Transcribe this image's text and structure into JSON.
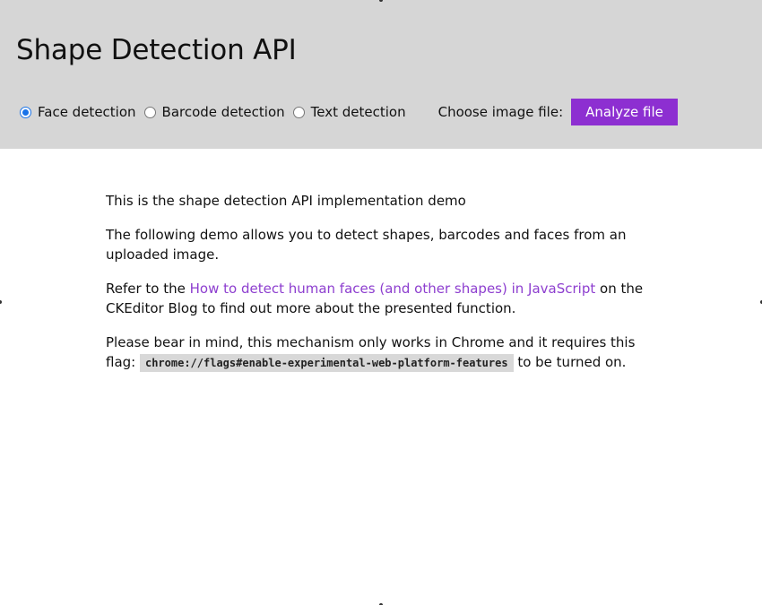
{
  "header": {
    "title": "Shape Detection API",
    "options": [
      {
        "label": "Face detection",
        "checked": true
      },
      {
        "label": "Barcode detection",
        "checked": false
      },
      {
        "label": "Text detection",
        "checked": false
      }
    ],
    "file_label": "Choose image file:",
    "analyze_label": "Analyze file"
  },
  "content": {
    "intro": "This is the shape detection API implementation demo",
    "description": "The following demo allows you to detect shapes, barcodes and faces from an uploaded image.",
    "refer_prefix": "Refer to the ",
    "refer_link": "How to detect human faces (and other shapes) in JavaScript",
    "refer_suffix": " on the CKEditor Blog to find out more about the presented function.",
    "warning_text": "Please bear in mind, this mechanism only works in Chrome and it requires this flag: ",
    "flag_code": "chrome://flags#enable-experimental-web-platform-features",
    "warning_suffix": " to be turned on."
  },
  "colors": {
    "header_bg": "#d6d6d6",
    "accent": "#8d2fd1",
    "link": "#8d3ecf"
  }
}
